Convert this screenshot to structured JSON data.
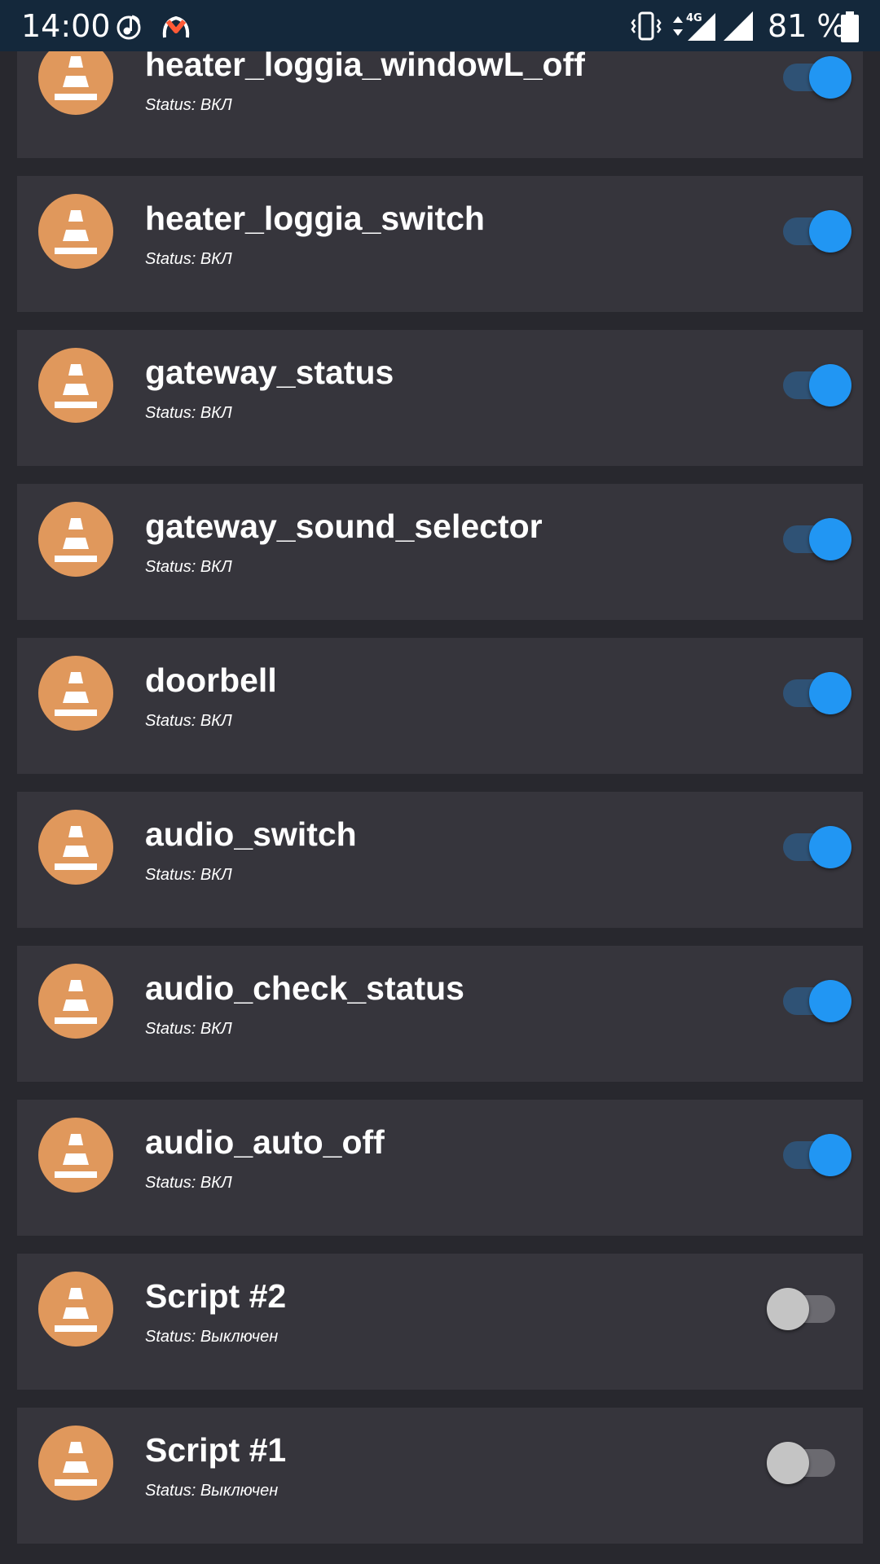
{
  "status_bar": {
    "time": "14:00",
    "battery_percent": "81 %",
    "network": "4G",
    "icons": [
      "music-note-icon",
      "app-notification-icon",
      "vibrate-icon",
      "data-arrows-icon",
      "signal-icon",
      "wifi-icon",
      "battery-icon"
    ]
  },
  "colors": {
    "background": "#28282e",
    "card": "#36353c",
    "status_bar": "#14283b",
    "avatar": "#e0985c",
    "toggle_on_thumb": "#2196f3",
    "toggle_on_track": "#2f5275",
    "toggle_off_thumb": "#c4c4c4",
    "toggle_off_track": "#6b6a70"
  },
  "items": [
    {
      "name": "heater_loggia_windowL_off",
      "status": "Status: ВКЛ",
      "on": true,
      "icon": "traffic-cone-icon"
    },
    {
      "name": "heater_loggia_switch",
      "status": "Status: ВКЛ",
      "on": true,
      "icon": "traffic-cone-icon"
    },
    {
      "name": "gateway_status",
      "status": "Status: ВКЛ",
      "on": true,
      "icon": "traffic-cone-icon"
    },
    {
      "name": "gateway_sound_selector",
      "status": "Status: ВКЛ",
      "on": true,
      "icon": "traffic-cone-icon"
    },
    {
      "name": "doorbell",
      "status": "Status: ВКЛ",
      "on": true,
      "icon": "traffic-cone-icon"
    },
    {
      "name": "audio_switch",
      "status": "Status: ВКЛ",
      "on": true,
      "icon": "traffic-cone-icon"
    },
    {
      "name": "audio_check_status",
      "status": "Status: ВКЛ",
      "on": true,
      "icon": "traffic-cone-icon"
    },
    {
      "name": "audio_auto_off",
      "status": "Status: ВКЛ",
      "on": true,
      "icon": "traffic-cone-icon"
    },
    {
      "name": "Script #2",
      "status": "Status: Выключен",
      "on": false,
      "icon": "traffic-cone-icon"
    },
    {
      "name": "Script #1",
      "status": "Status: Выключен",
      "on": false,
      "icon": "traffic-cone-icon"
    }
  ]
}
